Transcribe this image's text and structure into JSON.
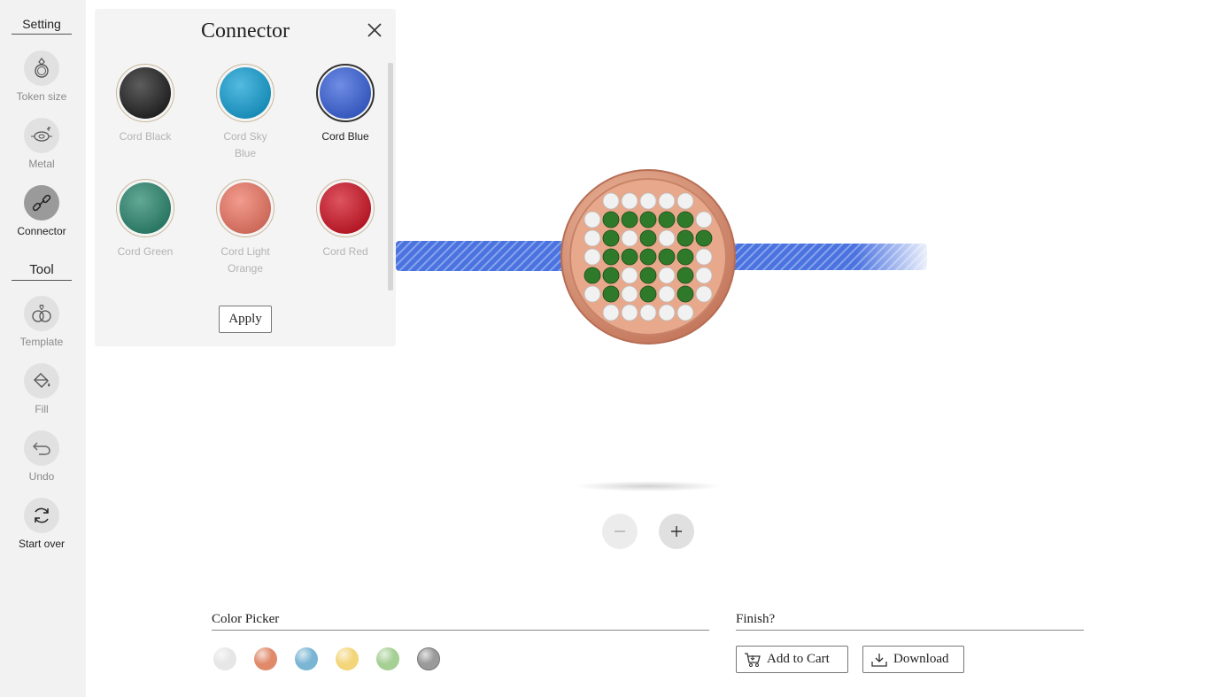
{
  "sidebar": {
    "setting_heading": "Setting",
    "tool_heading": "Tool",
    "items": [
      {
        "label": "Token size",
        "icon": "ring-icon"
      },
      {
        "label": "Metal",
        "icon": "metal-icon"
      },
      {
        "label": "Connector",
        "icon": "chain-link-icon",
        "active": true
      },
      {
        "label": "Template",
        "icon": "template-icon"
      },
      {
        "label": "Fill",
        "icon": "paint-bucket-icon"
      },
      {
        "label": "Undo",
        "icon": "undo-icon"
      },
      {
        "label": "Start over",
        "icon": "refresh-icon"
      }
    ]
  },
  "panel": {
    "title": "Connector",
    "apply_label": "Apply",
    "swatches": [
      {
        "name": "Cord Black",
        "color": "#262626"
      },
      {
        "name": "Cord Sky Blue",
        "color": "#1aa3d6"
      },
      {
        "name": "Cord Blue",
        "color": "#3e66dc",
        "selected": true
      },
      {
        "name": "Cord Green",
        "color": "#2f8a72"
      },
      {
        "name": "Cord Light Orange",
        "color": "#ef7a68"
      },
      {
        "name": "Cord Red",
        "color": "#d21a2a"
      }
    ]
  },
  "preview": {
    "cord_color": "#4a73e0",
    "metal_color": "#d99274",
    "stone_white": "#f1f1f1",
    "stone_green": "#2f7a2a"
  },
  "color_picker": {
    "title": "Color Picker",
    "colors": [
      "#e6e6e6",
      "#e08a6a",
      "#7ab5d3",
      "#f3d57a",
      "#a6cf94",
      "#9a9a9a"
    ]
  },
  "finish": {
    "title": "Finish?",
    "add_to_cart_label": "Add to Cart",
    "download_label": "Download"
  }
}
